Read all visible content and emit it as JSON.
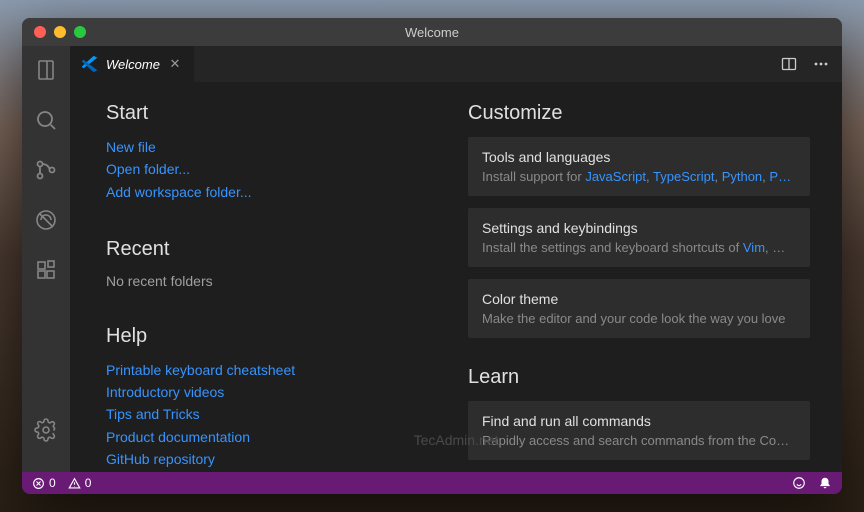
{
  "window": {
    "title": "Welcome"
  },
  "tabs": [
    {
      "label": "Welcome"
    }
  ],
  "welcome": {
    "start": {
      "heading": "Start",
      "links": [
        "New file",
        "Open folder...",
        "Add workspace folder..."
      ]
    },
    "recent": {
      "heading": "Recent",
      "empty": "No recent folders"
    },
    "help": {
      "heading": "Help",
      "links": [
        "Printable keyboard cheatsheet",
        "Introductory videos",
        "Tips and Tricks",
        "Product documentation",
        "GitHub repository"
      ]
    },
    "customize": {
      "heading": "Customize",
      "cards": [
        {
          "title": "Tools and languages",
          "desc_prefix": "Install support for ",
          "hl": [
            "JavaScript",
            "TypeScript",
            "Python",
            "P…"
          ]
        },
        {
          "title": "Settings and keybindings",
          "desc_prefix": "Install the settings and keyboard shortcuts of ",
          "hl": [
            "Vim"
          ],
          "desc_suffix": ", …"
        },
        {
          "title": "Color theme",
          "desc": "Make the editor and your code look the way you love"
        }
      ]
    },
    "learn": {
      "heading": "Learn",
      "cards": [
        {
          "title": "Find and run all commands",
          "desc": "Rapidly access and search commands from the Co…"
        }
      ]
    }
  },
  "statusbar": {
    "errors": "0",
    "warnings": "0"
  },
  "watermark": "TecAdmin.net",
  "colors": {
    "accent": "#3794ff",
    "statusbar": "#681a75",
    "bg": "#1e1e1e"
  }
}
